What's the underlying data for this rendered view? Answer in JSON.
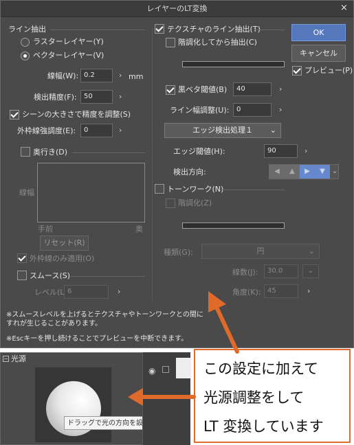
{
  "dialog": {
    "title": "レイヤーのLT変換",
    "close": "×"
  },
  "line_extract": {
    "heading": "ライン抽出",
    "raster": "ラスターレイヤー(Y)",
    "vector": "ベクターレイヤー(V)",
    "line_width_label": "線幅(W):",
    "line_width_value": "0.2",
    "unit": "mm",
    "precision_label": "検出精度(F):",
    "precision_value": "50",
    "scene_adjust": "シーンの大きさで精度を調整(S)",
    "outline_label": "外枠線強調度(E):",
    "outline_value": "0",
    "depth": "奥行き(D)",
    "graph_y": "線幅",
    "graph_x_left": "手前",
    "graph_x_right": "奥",
    "reset": "リセット(R)",
    "outer_only": "外枠線のみ適用(O)",
    "smooth": "スムース(S)",
    "level_label": "レベル(L):",
    "level_value": "6"
  },
  "texture": {
    "heading": "テクスチャのライン抽出(T)",
    "posterize": "階調化してから抽出(C)",
    "black_threshold": "黒ベタ閾値(B)",
    "black_threshold_value": "40",
    "line_width_adjust": "ライン幅調整(U):",
    "line_width_adjust_value": "0",
    "edge_process": "エッジ検出処理１",
    "edge_threshold": "エッジ閾値(H):",
    "edge_threshold_value": "90",
    "direction": "検出方向:"
  },
  "tone": {
    "heading": "トーンワーク(N)",
    "posterize": "階調化(Z)",
    "type_label": "種類(G):",
    "type_value": "円",
    "lines_label": "線数(J):",
    "lines_value": "30.0",
    "angle_label": "角度(K):",
    "angle_value": "45"
  },
  "buttons": {
    "ok": "OK",
    "cancel": "キャンセル",
    "preview": "プレビュー(P)"
  },
  "notes": {
    "note1": "※スムースレベルを上げるとテクスチャやトーンワークとの間に",
    "note2": "すれが生じることがあります。",
    "note3": "※Escキーを押し続けることでプレビューを中断できます。"
  },
  "light": {
    "panel_title": "光源",
    "tooltip": "ドラッグで光の方向を設定します"
  },
  "callout": {
    "line1": "この設定に加えて",
    "line2": "光源調整をして",
    "line3": "LT 変換しています"
  },
  "colors": {
    "arrow": "#e06a2a",
    "dialog_bg": "#4a4a4a",
    "accent": "#5577bb"
  }
}
